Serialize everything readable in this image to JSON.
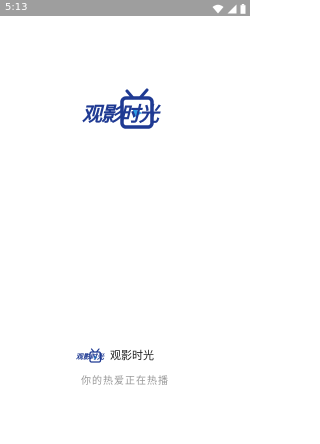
{
  "status_bar": {
    "time": "5:13",
    "icons": [
      "wifi-icon",
      "signal-icon",
      "battery-icon"
    ],
    "background": "#9e9e9e"
  },
  "logo": {
    "text": "观影时光",
    "color": "#1f3a93"
  },
  "footer": {
    "mini_logo_text": "观影时光",
    "app_name": "观影时光",
    "tagline": "你的热爱正在热播"
  }
}
